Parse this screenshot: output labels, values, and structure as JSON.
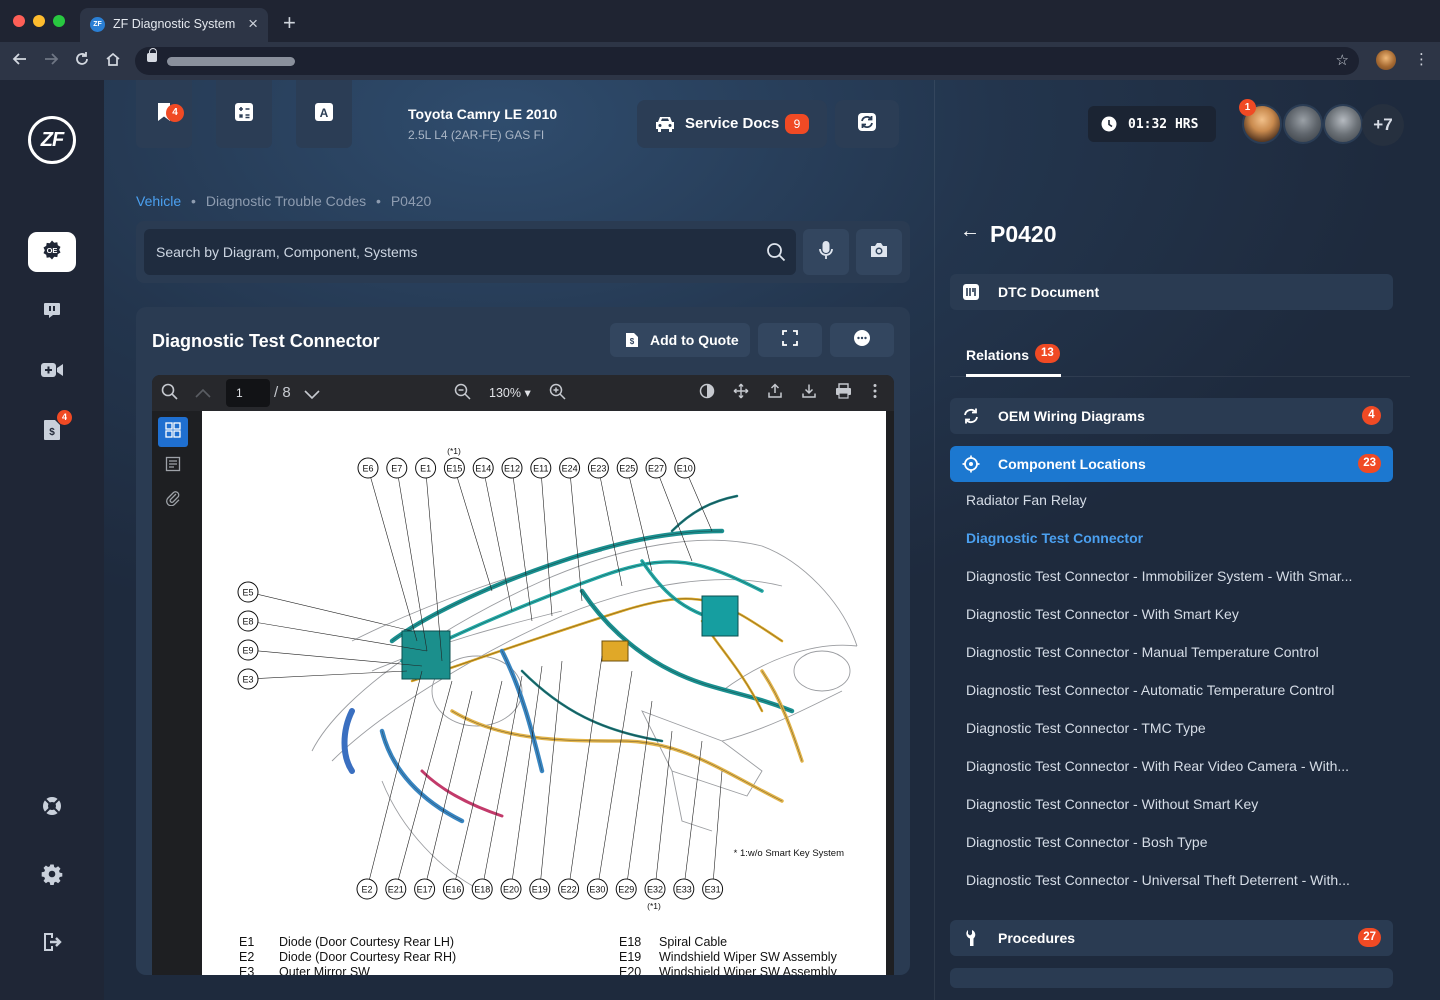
{
  "browser": {
    "tab_title": "ZF Diagnostic System",
    "tab_favicon": "ZF",
    "close_glyph": "×",
    "new_tab_glyph": "+"
  },
  "sidebar": {
    "logo": "ZF",
    "active_item": "OE",
    "quote_badge": "4",
    "icons": [
      "oe-icon",
      "chat-icon",
      "video-add-icon",
      "quote-icon",
      "support-icon",
      "gear-icon",
      "logout-icon"
    ]
  },
  "header": {
    "bookmark_badge": "4",
    "vehicle": {
      "name": "Toyota Camry LE 2010",
      "engine": "2.5L L4 (2AR-FE) GAS FI"
    },
    "service_docs": {
      "label": "Service Docs",
      "badge": "9"
    },
    "timer": "01:32 HRS",
    "users_badge": "1",
    "more_users": "+7"
  },
  "breadcrumb": {
    "items": [
      "Vehicle",
      "Diagnostic Trouble Codes",
      "P0420"
    ],
    "separator": "•"
  },
  "search": {
    "placeholder": "Search by Diagram, Component, Systems"
  },
  "document": {
    "title": "Diagnostic Test Connector",
    "add_to_quote": "Add to Quote",
    "viewer": {
      "page": "1",
      "total": "/ 8",
      "zoom": "130% ▾"
    },
    "diagram": {
      "top_note": "(*1)",
      "bottom_note": "(*1)",
      "footnote": "* 1:w/o Smart Key System",
      "top_labels": [
        "E6",
        "E7",
        "E1",
        "E15",
        "E14",
        "E12",
        "E11",
        "E24",
        "E23",
        "E25",
        "E27",
        "E10"
      ],
      "left_labels": [
        "E5",
        "E8",
        "E9",
        "E3"
      ],
      "bottom_labels": [
        "E2",
        "E21",
        "E17",
        "E16",
        "E18",
        "E20",
        "E19",
        "E22",
        "E30",
        "E29",
        "E32",
        "E33",
        "E31"
      ]
    },
    "legend": [
      {
        "code": "E1",
        "text": "Diode (Door Courtesy Rear LH)"
      },
      {
        "code": "E2",
        "text": "Diode (Door Courtesy Rear RH)"
      },
      {
        "code": "E3",
        "text": "Outer Mirror SW"
      },
      {
        "code": "E18",
        "text": "Spiral Cable"
      },
      {
        "code": "E19",
        "text": "Windshield Wiper SW Assembly"
      },
      {
        "code": "E20",
        "text": "Windshield Wiper SW Assembly"
      }
    ]
  },
  "right_panel": {
    "back_glyph": "←",
    "title": "P0420",
    "dtc_document": "DTC Document",
    "relations_tab": {
      "label": "Relations",
      "badge": "13"
    },
    "sections": [
      {
        "label": "OEM Wiring Diagrams",
        "badge": "4"
      },
      {
        "label": "Component Locations",
        "badge": "23"
      },
      {
        "label": "Procedures",
        "badge": "27"
      }
    ],
    "items": [
      "Radiator Fan Relay",
      "Diagnostic Test Connector",
      "Diagnostic Test Connector - Immobilizer System - With Smar...",
      "Diagnostic Test Connector - With Smart Key",
      "Diagnostic Test Connector - Manual Temperature Control",
      "Diagnostic Test Connector - Automatic Temperature Control",
      "Diagnostic Test Connector - TMC Type",
      "Diagnostic Test Connector - With Rear Video Camera - With...",
      "Diagnostic Test Connector - Without Smart Key",
      "Diagnostic Test Connector - Bosh Type",
      "Diagnostic Test Connector - Universal Theft Deterrent - With..."
    ]
  }
}
